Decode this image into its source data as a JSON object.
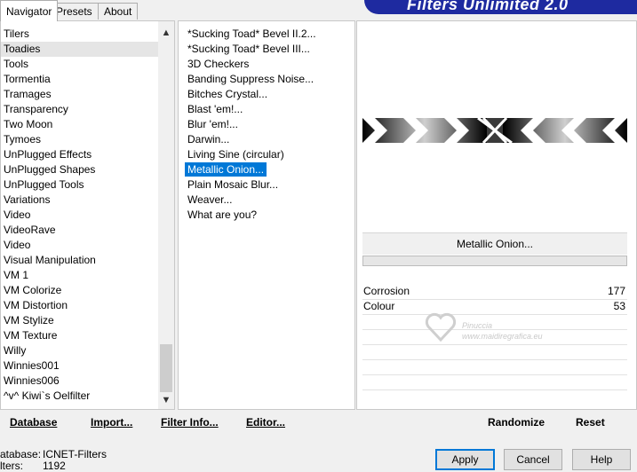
{
  "tabs": [
    {
      "label": "Navigator"
    },
    {
      "label": "Presets"
    },
    {
      "label": "About"
    }
  ],
  "banner": {
    "title": "Filters Unlimited 2.0"
  },
  "categories": {
    "items": [
      "Tilers",
      "Toadies",
      "Tools",
      "Tormentia",
      "Tramages",
      "Transparency",
      "Two Moon",
      "Tymoes",
      "UnPlugged Effects",
      "UnPlugged Shapes",
      "UnPlugged Tools",
      "Variations",
      "Video",
      "VideoRave",
      "Video",
      "Visual Manipulation",
      "VM 1",
      "VM Colorize",
      "VM Distortion",
      "VM Stylize",
      "VM Texture",
      "Willy",
      "Winnies001",
      "Winnies006",
      "^v^ Kiwi`s Oelfilter"
    ],
    "selected": "Toadies"
  },
  "filters": {
    "items": [
      "*Sucking Toad*  Bevel II.2...",
      "*Sucking Toad*  Bevel III...",
      "3D Checkers",
      "Banding Suppress Noise...",
      "Bitches Crystal...",
      "Blast 'em!...",
      "Blur 'em!...",
      "Darwin...",
      "Living Sine (circular)",
      "Metallic Onion...",
      "Plain Mosaic Blur...",
      "Weaver...",
      "What are you?"
    ],
    "selected": "Metallic Onion..."
  },
  "preview": {
    "filter_name": "Metallic Onion...",
    "params": [
      {
        "label": "Corrosion",
        "value": "177"
      },
      {
        "label": "Colour",
        "value": "53"
      }
    ]
  },
  "watermark": {
    "line1": "Pinuccia",
    "line2": "www.maidiregrafica.eu"
  },
  "left_actions": {
    "database": "Database",
    "import": "Import...",
    "filter_info": "Filter Info...",
    "editor": "Editor..."
  },
  "right_actions": {
    "randomize": "Randomize",
    "reset": "Reset"
  },
  "status": {
    "database_label": "atabase:",
    "database_value": "ICNET-Filters",
    "filters_label": "lters:",
    "filters_value": "1192"
  },
  "dialog": {
    "apply": "Apply",
    "cancel": "Cancel",
    "help": "Help"
  }
}
